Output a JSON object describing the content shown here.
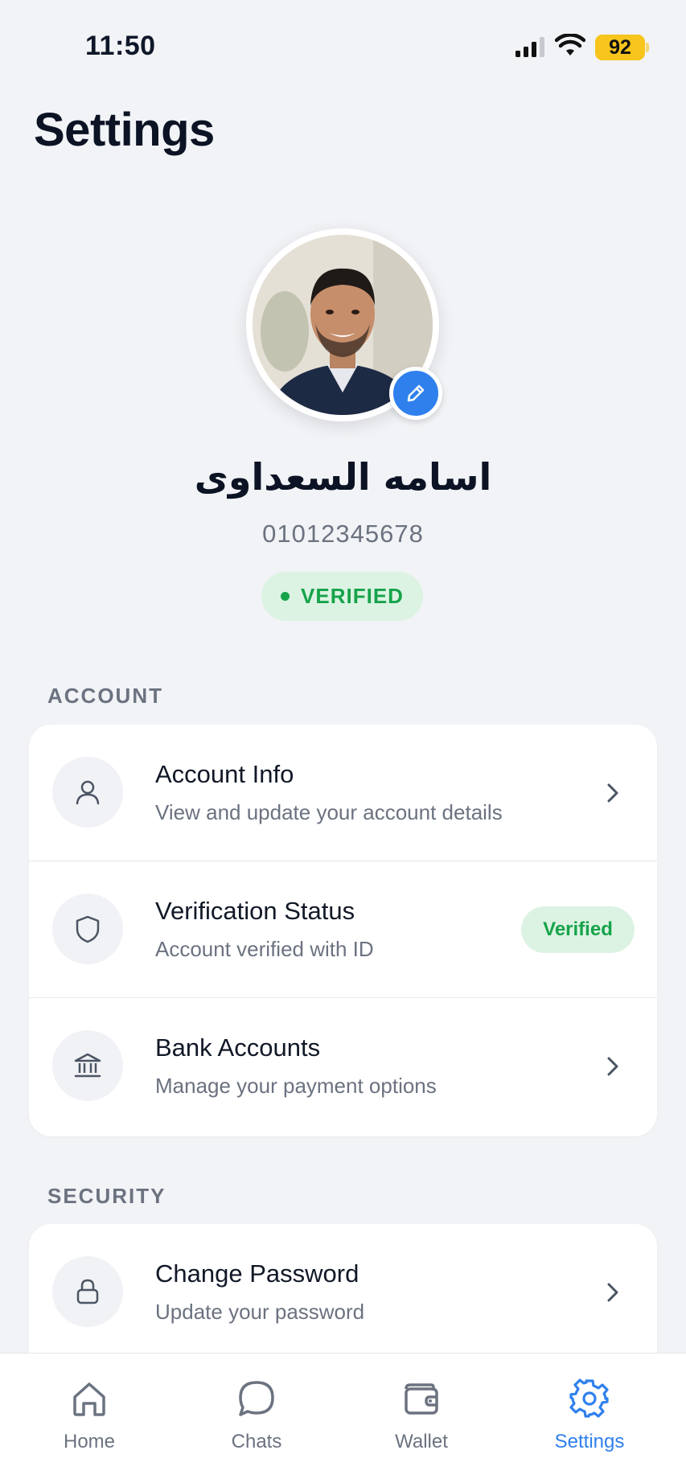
{
  "status_bar": {
    "time": "11:50",
    "battery": "92"
  },
  "page": {
    "title": "Settings"
  },
  "profile": {
    "name": "اسامه السعداوى",
    "phone": "01012345678",
    "status": "VERIFIED"
  },
  "sections": {
    "account": {
      "label": "ACCOUNT",
      "items": [
        {
          "title": "Account Info",
          "subtitle": "View and update your account details",
          "icon": "user-icon"
        },
        {
          "title": "Verification Status",
          "subtitle": "Account verified with ID",
          "badge": "Verified",
          "icon": "shield-icon"
        },
        {
          "title": "Bank Accounts",
          "subtitle": "Manage your payment options",
          "icon": "bank-icon"
        }
      ]
    },
    "security": {
      "label": "SECURITY",
      "items": [
        {
          "title": "Change Password",
          "subtitle": "Update your password",
          "icon": "lock-icon"
        }
      ]
    }
  },
  "tabs": [
    {
      "label": "Home",
      "icon": "home-icon"
    },
    {
      "label": "Chats",
      "icon": "chat-icon"
    },
    {
      "label": "Wallet",
      "icon": "wallet-icon"
    },
    {
      "label": "Settings",
      "icon": "gear-icon",
      "active": true
    }
  ],
  "colors": {
    "accent": "#2f80ed",
    "success": "#16a34a",
    "success_bg": "#dcf3e3",
    "battery": "#f7c51b"
  }
}
